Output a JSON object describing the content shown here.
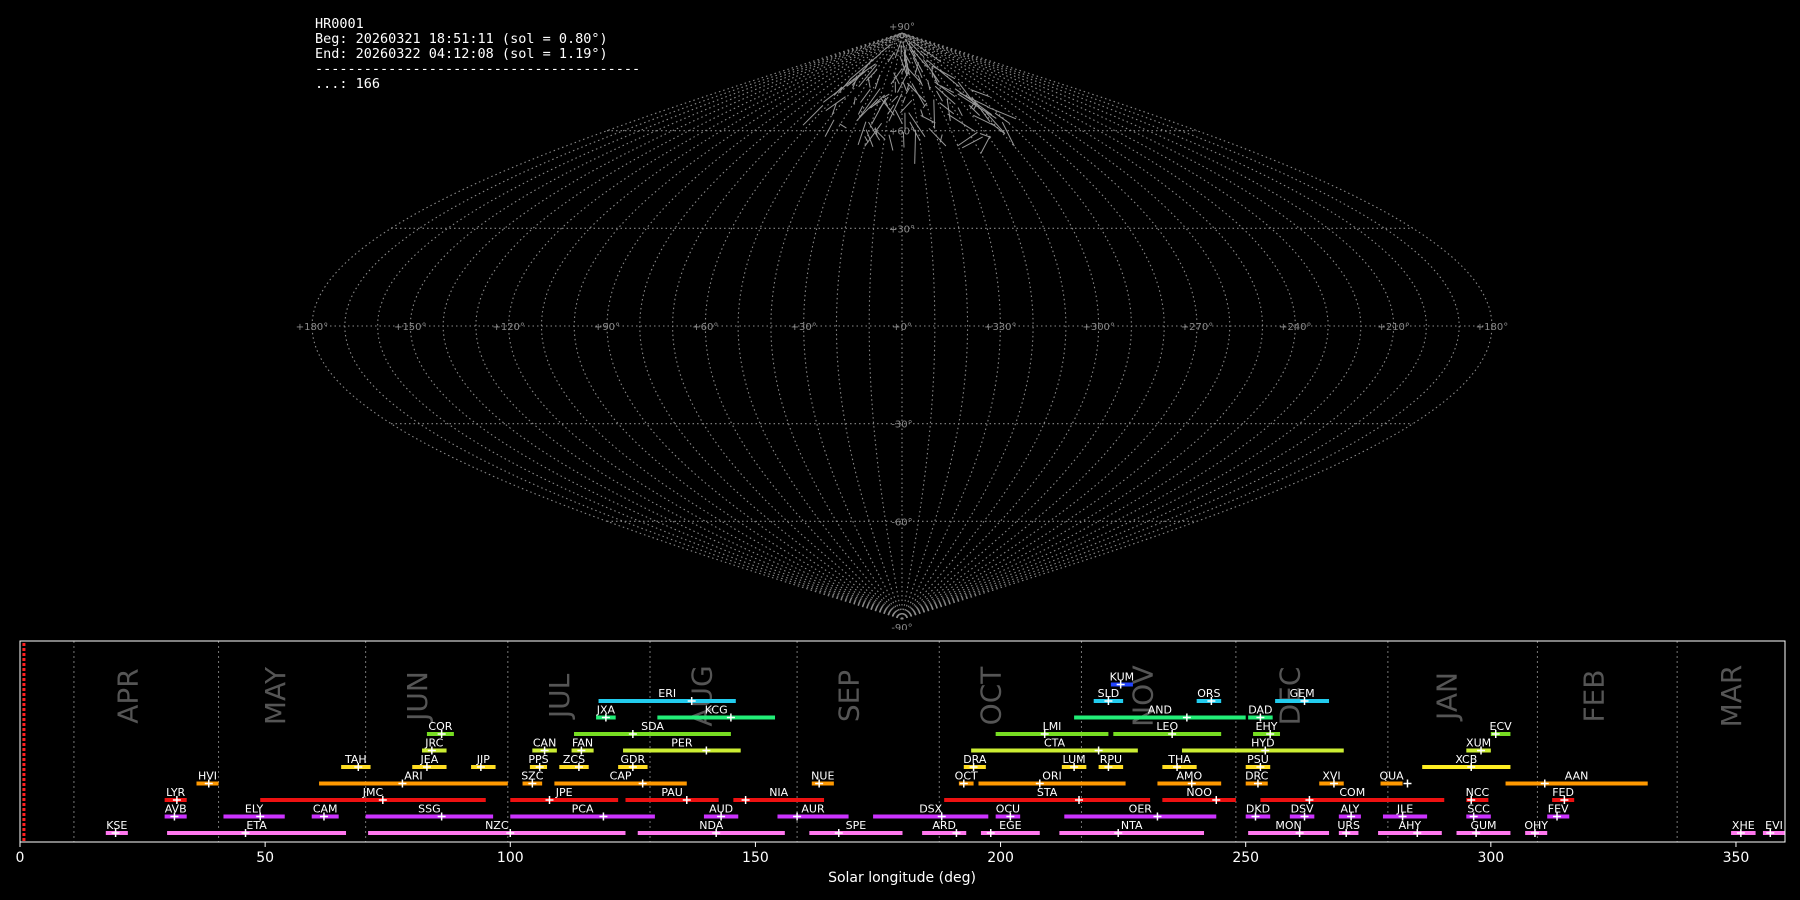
{
  "info": {
    "id": "HR0001",
    "beg": "Beg: 20260321 18:51:11 (sol = 0.80°)",
    "end": "End: 20260322 04:12:08 (sol = 1.19°)",
    "sep": "----------------------------------------",
    "count": "...: 166"
  },
  "colors": {
    "grid": "#8a8a8a",
    "frame": "#ffffff",
    "marker": "#ff2020",
    "month": "#555555"
  },
  "chart_data": [
    {
      "type": "scatter",
      "projection": "sinusoidal (all-sky map)",
      "lon_tick_labels": [
        "+180°",
        "+150°",
        "+120°",
        "+90°",
        "+60°",
        "+30°",
        "+0°",
        "+330°",
        "+300°",
        "+270°",
        "+240°",
        "+210°",
        "+180°"
      ],
      "lat_tick_labels": [
        "+90°",
        "+60°",
        "+30°",
        "-30°",
        "-60°",
        "-90°"
      ],
      "grid": true,
      "trails_description_note_free": null
    },
    {
      "type": "bar",
      "xlabel": "Solar longitude (deg)",
      "xlim": [
        0,
        360
      ],
      "xticks": [
        "0",
        "50",
        "100",
        "150",
        "200",
        "250",
        "300",
        "350"
      ],
      "current_solar_longitude": 0.8,
      "month_boundaries": [
        11,
        40.5,
        70.5,
        99.5,
        128.5,
        158.5,
        187.5,
        216.5,
        248,
        279,
        309.5,
        338
      ],
      "months": [
        {
          "name": "APR",
          "x": 24
        },
        {
          "name": "MAY",
          "x": 54
        },
        {
          "name": "JUN",
          "x": 83
        },
        {
          "name": "JUL",
          "x": 112
        },
        {
          "name": "AUG",
          "x": 141
        },
        {
          "name": "SEP",
          "x": 171
        },
        {
          "name": "OCT",
          "x": 200
        },
        {
          "name": "NOV",
          "x": 231
        },
        {
          "name": "DEC",
          "x": 261
        },
        {
          "name": "JAN",
          "x": 293
        },
        {
          "name": "FEB",
          "x": 323
        },
        {
          "name": "MAR",
          "x": 351
        }
      ],
      "showers": [
        {
          "code": "KSE",
          "start": 17.5,
          "end": 22,
          "peak": 19.5,
          "row": 0,
          "color": "#ff77ee"
        },
        {
          "code": "ETA",
          "start": 30,
          "end": 66.5,
          "peak": 46,
          "row": 0,
          "color": "#ff77ee"
        },
        {
          "code": "NZC",
          "start": 71,
          "end": 123.5,
          "peak": 100,
          "row": 0,
          "color": "#ff77ee"
        },
        {
          "code": "NDA",
          "start": 126,
          "end": 156,
          "peak": 142,
          "row": 0,
          "color": "#ff77ee"
        },
        {
          "code": "SPE",
          "start": 161,
          "end": 180,
          "peak": 167,
          "row": 0,
          "color": "#ff77ee"
        },
        {
          "code": "ARD",
          "start": 184,
          "end": 193,
          "peak": 191,
          "row": 0,
          "color": "#ff77ee"
        },
        {
          "code": "EGE",
          "start": 196,
          "end": 208,
          "peak": 198,
          "row": 0,
          "color": "#ff77ee"
        },
        {
          "code": "NTA",
          "start": 212,
          "end": 241.5,
          "peak": 224,
          "row": 0,
          "color": "#ff77ee"
        },
        {
          "code": "MON",
          "start": 250.5,
          "end": 267,
          "peak": 261,
          "row": 0,
          "color": "#ff77ee"
        },
        {
          "code": "URS",
          "start": 269,
          "end": 273,
          "peak": 270.5,
          "row": 0,
          "color": "#ff77ee"
        },
        {
          "code": "AHY",
          "start": 277,
          "end": 290,
          "peak": 285,
          "row": 0,
          "color": "#ff77ee"
        },
        {
          "code": "GUM",
          "start": 293,
          "end": 304,
          "peak": 297,
          "row": 0,
          "color": "#ff77ee"
        },
        {
          "code": "OHY",
          "start": 307,
          "end": 311.5,
          "peak": 309,
          "row": 0,
          "color": "#ff77ee"
        },
        {
          "code": "XHE",
          "start": 349,
          "end": 354,
          "peak": 351,
          "row": 0,
          "color": "#ff77ee"
        },
        {
          "code": "EVI",
          "start": 355.5,
          "end": 360,
          "peak": 357,
          "row": 0,
          "color": "#ff77ee"
        },
        {
          "code": "AVB",
          "start": 29.5,
          "end": 34,
          "peak": 31.5,
          "row": 1,
          "color": "#cc33ff"
        },
        {
          "code": "ELY",
          "start": 41.5,
          "end": 54,
          "peak": 49,
          "row": 1,
          "color": "#cc33ff"
        },
        {
          "code": "CAM",
          "start": 59.5,
          "end": 65,
          "peak": 62,
          "row": 1,
          "color": "#cc33ff"
        },
        {
          "code": "SSG",
          "start": 70.5,
          "end": 96.5,
          "peak": 86,
          "row": 1,
          "color": "#cc33ff"
        },
        {
          "code": "PCA",
          "start": 100,
          "end": 129.5,
          "peak": 119,
          "row": 1,
          "color": "#cc33ff"
        },
        {
          "code": "AUD",
          "start": 139.5,
          "end": 146.5,
          "peak": 143,
          "row": 1,
          "color": "#cc33ff"
        },
        {
          "code": "AUR",
          "start": 154.5,
          "end": 169,
          "peak": 158.5,
          "row": 1,
          "color": "#cc33ff"
        },
        {
          "code": "DSX",
          "start": 174,
          "end": 197.5,
          "peak": 188,
          "row": 1,
          "color": "#cc33ff"
        },
        {
          "code": "OCU",
          "start": 199,
          "end": 204,
          "peak": 202,
          "row": 1,
          "color": "#cc33ff"
        },
        {
          "code": "OER",
          "start": 213,
          "end": 244,
          "peak": 232,
          "row": 1,
          "color": "#cc33ff"
        },
        {
          "code": "DKD",
          "start": 250,
          "end": 255,
          "peak": 252,
          "row": 1,
          "color": "#cc33ff"
        },
        {
          "code": "DSV",
          "start": 259,
          "end": 264,
          "peak": 262,
          "row": 1,
          "color": "#cc33ff"
        },
        {
          "code": "ALY",
          "start": 269,
          "end": 273.5,
          "peak": 271.5,
          "row": 1,
          "color": "#cc33ff"
        },
        {
          "code": "JLE",
          "start": 278,
          "end": 287,
          "peak": 282,
          "row": 1,
          "color": "#cc33ff"
        },
        {
          "code": "SCC",
          "start": 295,
          "end": 300,
          "peak": 296.5,
          "row": 1,
          "color": "#cc33ff"
        },
        {
          "code": "FEV",
          "start": 311.5,
          "end": 316,
          "peak": 313.5,
          "row": 1,
          "color": "#cc33ff"
        },
        {
          "code": "LYR",
          "start": 29.5,
          "end": 34,
          "peak": 32,
          "row": 2,
          "color": "#ee1111"
        },
        {
          "code": "JMC",
          "start": 49,
          "end": 95,
          "peak": 74,
          "row": 2,
          "color": "#ee1111"
        },
        {
          "code": "JPE",
          "start": 100,
          "end": 122,
          "peak": 108,
          "row": 2,
          "color": "#ee1111"
        },
        {
          "code": "PAU",
          "start": 123.5,
          "end": 142.5,
          "peak": 136,
          "row": 2,
          "color": "#ee1111"
        },
        {
          "code": "NIA",
          "start": 145.5,
          "end": 164,
          "peak": 148,
          "row": 2,
          "color": "#ee1111"
        },
        {
          "code": "STA",
          "start": 188.5,
          "end": 230.5,
          "peak": 216,
          "row": 2,
          "color": "#ee1111"
        },
        {
          "code": "NOO",
          "start": 233,
          "end": 248,
          "peak": 244,
          "row": 2,
          "color": "#ee1111"
        },
        {
          "code": "COM",
          "start": 253,
          "end": 290.5,
          "peak": 263,
          "row": 2,
          "color": "#ee1111"
        },
        {
          "code": "NCC",
          "start": 295,
          "end": 299.5,
          "peak": 296,
          "row": 2,
          "color": "#ee1111"
        },
        {
          "code": "FED",
          "start": 312.5,
          "end": 317,
          "peak": 315,
          "row": 2,
          "color": "#ee1111"
        },
        {
          "code": "HVI",
          "start": 36,
          "end": 40.5,
          "peak": 38.5,
          "row": 3,
          "color": "#ff9900"
        },
        {
          "code": "ARI",
          "start": 61,
          "end": 99.5,
          "peak": 78,
          "row": 3,
          "color": "#ff9900"
        },
        {
          "code": "SZC",
          "start": 102.5,
          "end": 106.5,
          "peak": 104.5,
          "row": 3,
          "color": "#ff9900"
        },
        {
          "code": "CAP",
          "start": 109,
          "end": 136,
          "peak": 127,
          "row": 3,
          "color": "#ff9900"
        },
        {
          "code": "NUE",
          "start": 161.5,
          "end": 166,
          "peak": 163,
          "row": 3,
          "color": "#ff9900"
        },
        {
          "code": "OCT",
          "start": 191.5,
          "end": 194.5,
          "peak": 192.5,
          "row": 3,
          "color": "#ff9900"
        },
        {
          "code": "ORI",
          "start": 195.5,
          "end": 225.5,
          "peak": 208,
          "row": 3,
          "color": "#ff9900"
        },
        {
          "code": "AMO",
          "start": 232,
          "end": 245,
          "peak": 239,
          "row": 3,
          "color": "#ff9900"
        },
        {
          "code": "DRC",
          "start": 250,
          "end": 254.5,
          "peak": 252.5,
          "row": 3,
          "color": "#ff9900"
        },
        {
          "code": "XVI",
          "start": 265,
          "end": 270,
          "peak": 268,
          "row": 3,
          "color": "#ff9900"
        },
        {
          "code": "QUA",
          "start": 277.5,
          "end": 282,
          "peak": 283,
          "row": 3,
          "color": "#ff9900"
        },
        {
          "code": "AAN",
          "start": 303,
          "end": 332,
          "peak": 311,
          "row": 3,
          "color": "#ff9900"
        },
        {
          "code": "TAH",
          "start": 65.5,
          "end": 71.5,
          "peak": 69,
          "row": 4,
          "color": "#ffdd22"
        },
        {
          "code": "JEA",
          "start": 80,
          "end": 87,
          "peak": 83,
          "row": 4,
          "color": "#ffdd22"
        },
        {
          "code": "JIP",
          "start": 92,
          "end": 97,
          "peak": 94,
          "row": 4,
          "color": "#ffdd22"
        },
        {
          "code": "PPS",
          "start": 104,
          "end": 107.5,
          "peak": 106,
          "row": 4,
          "color": "#ffdd22"
        },
        {
          "code": "ZCS",
          "start": 110,
          "end": 116,
          "peak": 114,
          "row": 4,
          "color": "#ffdd22"
        },
        {
          "code": "GDR",
          "start": 122,
          "end": 128,
          "peak": 125,
          "row": 4,
          "color": "#ffdd22"
        },
        {
          "code": "DRA",
          "start": 192.5,
          "end": 197,
          "peak": 194.5,
          "row": 4,
          "color": "#ffdd22"
        },
        {
          "code": "LUM",
          "start": 212.5,
          "end": 217.5,
          "peak": 215,
          "row": 4,
          "color": "#ffdd22"
        },
        {
          "code": "RPU",
          "start": 220,
          "end": 225,
          "peak": 222,
          "row": 4,
          "color": "#ffdd22"
        },
        {
          "code": "THA",
          "start": 233,
          "end": 240,
          "peak": 236,
          "row": 4,
          "color": "#ffdd22"
        },
        {
          "code": "PSU",
          "start": 250,
          "end": 255,
          "peak": 253,
          "row": 4,
          "color": "#ffdd22"
        },
        {
          "code": "XCB",
          "start": 286,
          "end": 304,
          "peak": 296,
          "row": 4,
          "color": "#ffee22"
        },
        {
          "code": "JRC",
          "start": 82,
          "end": 87,
          "peak": 84,
          "row": 5,
          "color": "#ccee33"
        },
        {
          "code": "CAN",
          "start": 104.5,
          "end": 109.5,
          "peak": 107,
          "row": 5,
          "color": "#ccee33"
        },
        {
          "code": "FAN",
          "start": 112.5,
          "end": 117,
          "peak": 114.5,
          "row": 5,
          "color": "#ccee33"
        },
        {
          "code": "PER",
          "start": 123,
          "end": 147,
          "peak": 140,
          "row": 5,
          "color": "#ccee33"
        },
        {
          "code": "CTA",
          "start": 194,
          "end": 228,
          "peak": 220,
          "row": 5,
          "color": "#ccee33"
        },
        {
          "code": "HYD",
          "start": 237,
          "end": 270,
          "peak": 254,
          "row": 5,
          "color": "#ccee33"
        },
        {
          "code": "XUM",
          "start": 295,
          "end": 300,
          "peak": 298,
          "row": 5,
          "color": "#ccee33"
        },
        {
          "code": "COR",
          "start": 83,
          "end": 88.5,
          "peak": 86,
          "row": 6,
          "color": "#77dd22"
        },
        {
          "code": "SDA",
          "start": 113,
          "end": 145,
          "peak": 125,
          "row": 6,
          "color": "#77dd22"
        },
        {
          "code": "LMI",
          "start": 199,
          "end": 222,
          "peak": 209,
          "row": 6,
          "color": "#77dd22"
        },
        {
          "code": "LEO",
          "start": 223,
          "end": 245,
          "peak": 235,
          "row": 6,
          "color": "#77dd22"
        },
        {
          "code": "EHY",
          "start": 251.5,
          "end": 257,
          "peak": 255,
          "row": 6,
          "color": "#77dd22"
        },
        {
          "code": "ECV",
          "start": 300,
          "end": 304,
          "peak": 301,
          "row": 6,
          "color": "#77dd22"
        },
        {
          "code": "JXA",
          "start": 117.5,
          "end": 121.5,
          "peak": 119.5,
          "row": 7,
          "color": "#22ee77"
        },
        {
          "code": "KCG",
          "start": 130,
          "end": 154,
          "peak": 145,
          "row": 7,
          "color": "#22ee77"
        },
        {
          "code": "AND",
          "start": 215,
          "end": 250,
          "peak": 238,
          "row": 7,
          "color": "#22ee77"
        },
        {
          "code": "DAD",
          "start": 250.5,
          "end": 255.5,
          "peak": 253,
          "row": 7,
          "color": "#22ee77"
        },
        {
          "code": "ERI",
          "start": 118,
          "end": 146,
          "peak": 137,
          "row": 8,
          "color": "#22ccee"
        },
        {
          "code": "SLD",
          "start": 219,
          "end": 225,
          "peak": 222,
          "row": 8,
          "color": "#22ccee"
        },
        {
          "code": "ORS",
          "start": 240,
          "end": 245,
          "peak": 243,
          "row": 8,
          "color": "#22ccee"
        },
        {
          "code": "GEM",
          "start": 256,
          "end": 267,
          "peak": 262,
          "row": 8,
          "color": "#22ccee"
        },
        {
          "code": "KUM",
          "start": 222.5,
          "end": 227,
          "peak": 224.5,
          "row": 9,
          "color": "#2244ff"
        }
      ]
    }
  ]
}
